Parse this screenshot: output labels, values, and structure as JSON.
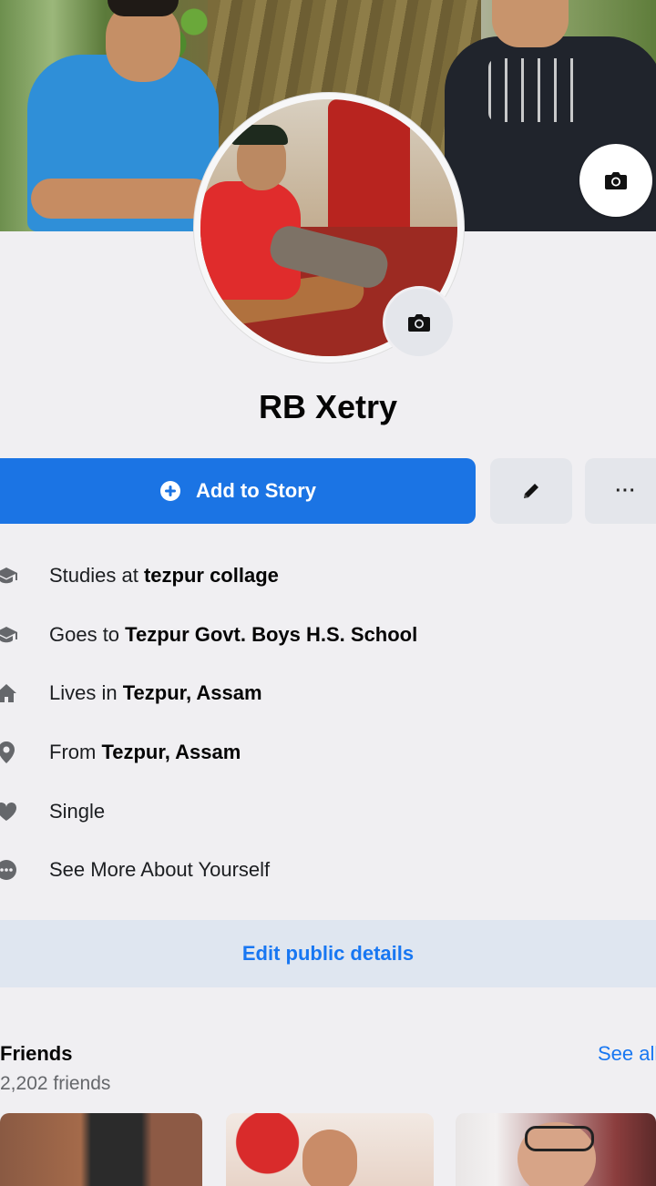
{
  "profile": {
    "name": "RB Xetry"
  },
  "actions": {
    "add_story_label": "Add to Story",
    "more_label": "···"
  },
  "details": [
    {
      "icon": "graduation-cap-icon",
      "prefix": "Studies at ",
      "value": "tezpur collage"
    },
    {
      "icon": "graduation-cap-icon",
      "prefix": "Goes to ",
      "value": "Tezpur Govt. Boys H.S. School"
    },
    {
      "icon": "home-icon",
      "prefix": "Lives in ",
      "value": "Tezpur, Assam"
    },
    {
      "icon": "location-pin-icon",
      "prefix": "From ",
      "value": "Tezpur, Assam"
    },
    {
      "icon": "heart-icon",
      "prefix": "",
      "value": "Single"
    },
    {
      "icon": "more-dots-icon",
      "prefix": "",
      "value": "See More About Yourself"
    }
  ],
  "edit_public_label": "Edit public details",
  "friends": {
    "title": "Friends",
    "count": "2,202 friends",
    "see_all": "See all"
  },
  "colors": {
    "primary_blue": "#1b74e4",
    "link_blue": "#1877f2",
    "background": "#f0eff2",
    "button_grey": "#e4e6eb"
  }
}
